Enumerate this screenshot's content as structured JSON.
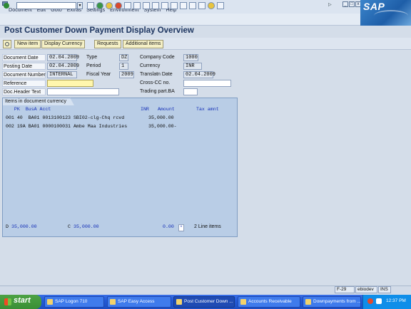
{
  "menu": [
    "Document",
    "Edit",
    "Goto",
    "Extras",
    "Settings",
    "Environment",
    "System",
    "Help"
  ],
  "window_controls": [
    "_",
    "□",
    "x"
  ],
  "brand": "SAP",
  "title": "Post Customer Down Payment Display Overview",
  "app_toolbar": {
    "new_item": "New item",
    "display_currency": "Display Currency",
    "requests": "Requests",
    "additional_items": "Additional items"
  },
  "header": {
    "document_date": {
      "label": "Document Date",
      "value": "02.04.2009"
    },
    "type": {
      "label": "Type",
      "value": "DZ"
    },
    "company_code": {
      "label": "Company Code",
      "value": "1000"
    },
    "posting_date": {
      "label": "Posting Date",
      "value": "02.04.2009"
    },
    "period": {
      "label": "Period",
      "value": "1"
    },
    "currency": {
      "label": "Currency",
      "value": "INR"
    },
    "document_number": {
      "label": "Document Number",
      "value": "INTERNAL"
    },
    "fiscal_year": {
      "label": "Fiscal Year",
      "value": "2009"
    },
    "translation_date": {
      "label": "Translatn Date",
      "value": "02.04.2009"
    },
    "reference": {
      "label": "Reference",
      "value": ""
    },
    "cross_cc": {
      "label": "Cross-CC no.",
      "value": ""
    },
    "doc_header_text": {
      "label": "Doc.Header Text",
      "value": ""
    },
    "trading_part": {
      "label": "Trading part.BA",
      "value": ""
    }
  },
  "items": {
    "tab_label": "Items in document currency",
    "columns_left": "   PK  BusA Acct",
    "columns_currency": "INR",
    "columns_amount": "Amount",
    "columns_tax": "Tax amnt",
    "rows": [
      {
        "text": "001 40  BA01 0013100123 SBI02-clg-Chq rcvd",
        "amount": "35,000.00"
      },
      {
        "text": "002 19A BA01 0000100031 Ambe Maa Industries",
        "amount": "35,000.00-"
      }
    ],
    "footer": {
      "debit_marker": "D",
      "debit": "35,000.00",
      "credit_marker": "C",
      "credit": "35,000.00",
      "balance": "0.00",
      "balance_star": "*",
      "line_items": "2 Line items"
    }
  },
  "status": {
    "transaction": "F-29",
    "server": "ebiodev",
    "mode": "INS"
  },
  "taskbar": {
    "start": "start",
    "tasks": [
      "SAP Logon 710",
      "SAP Easy Access",
      "Post Customer Down ...",
      "Accounts Receivable",
      "Downpayments from ..."
    ],
    "clock": "12:37 PM"
  }
}
